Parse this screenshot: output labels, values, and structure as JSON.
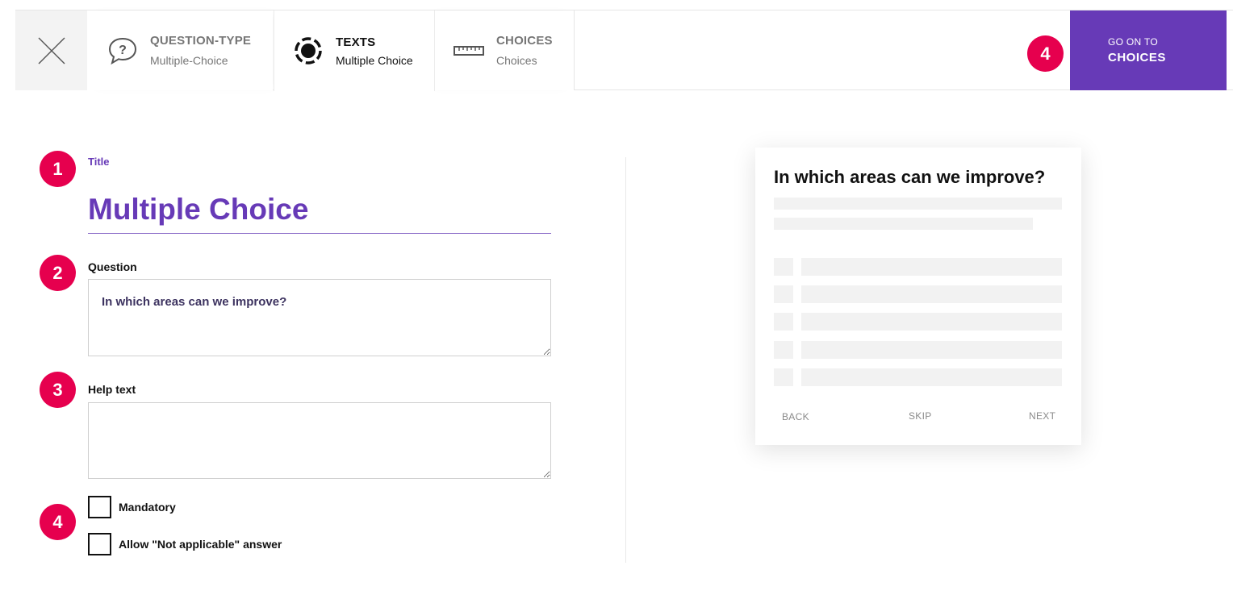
{
  "header": {
    "close_icon": "close-icon",
    "tabs": [
      {
        "title": "QUESTION-TYPE",
        "subtitle": "Multiple-Choice",
        "icon": "speech-bubble-question-icon",
        "active": false
      },
      {
        "title": "TEXTS",
        "subtitle": "Multiple Choice",
        "icon": "radio-target-icon",
        "active": true
      },
      {
        "title": "CHOICES",
        "subtitle": "Choices",
        "icon": "ruler-icon",
        "active": false
      }
    ],
    "step_badge": "4",
    "next_button": {
      "small_label": "GO ON TO",
      "big_label": "CHOICES"
    }
  },
  "colors": {
    "accent": "#673ab7",
    "badge": "#e6004e"
  },
  "form": {
    "title": {
      "badge": "1",
      "label": "Title",
      "value": "Multiple Choice"
    },
    "question": {
      "badge": "2",
      "label": "Question",
      "value": "In which areas can we improve?"
    },
    "help_text": {
      "badge": "3",
      "label": "Help text",
      "value": ""
    },
    "options": {
      "badge": "4",
      "mandatory": {
        "label": "Mandatory",
        "checked": false
      },
      "not_applicable": {
        "label": "Allow \"Not applicable\" answer",
        "checked": false
      }
    }
  },
  "preview": {
    "question": "In which areas can we improve?",
    "nav": {
      "back": "BACK",
      "skip": "SKIP",
      "next": "NEXT"
    }
  }
}
